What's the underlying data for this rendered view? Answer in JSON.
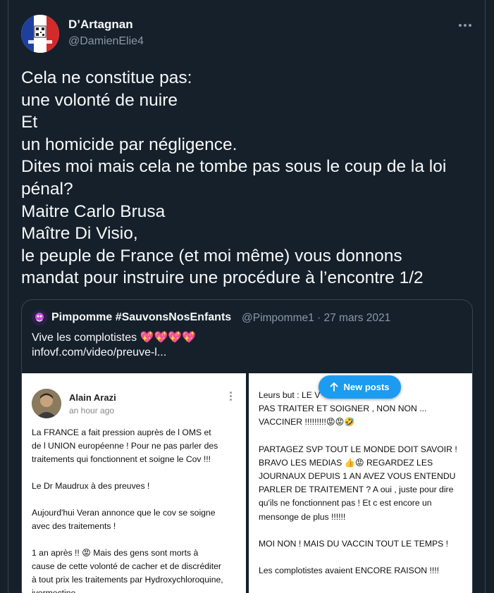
{
  "tweet": {
    "display_name": "D’Artagnan",
    "handle": "@DamienElie4",
    "text_lines": [
      "Cela ne constitue pas:",
      "une volonté de nuire",
      "Et",
      "un homicide par négligence.",
      "Dites moi mais cela ne tombe pas sous le coup de la loi",
      "pénal?",
      "Maitre Carlo Brusa",
      "Maître Di Visio,",
      "le peuple de France (et moi même) vous donnons",
      "mandat pour instruire une procédure à l’encontre 1/2"
    ]
  },
  "quoted": {
    "display_name": "Pimpomme #SauvonsNosEnfants",
    "meta": "@Pimpomme1 · 27 mars 2021",
    "text": "Vive les complotistes 💖💖💖💖",
    "link": "infovf.com/video/preuve-l..."
  },
  "screenshot_left": {
    "author": "Alain Arazi",
    "time": "an hour ago",
    "paragraphs": [
      "La FRANCE a fait pression auprès de l OMS et\nde l UNION européenne ! Pour ne pas parler des\ntraitements qui fonctionnent et soigne le Cov !!!",
      "Le Dr Maudrux à des preuves !",
      "Aujourd'hui Veran annonce que le cov se soigne\navec des traitements !",
      "1 an après !! 😡   Mais des gens sont morts à\ncause de cette volonté de cacher et de discréditer\nà  tout prix les traitements par Hydroxychloroquine,\nivermectine..."
    ]
  },
  "screenshot_right": {
    "paragraphs": [
      "Leurs but :   LE V\nPAS TRAITER ET SOIGNER , NON NON ...\nVACCINER !!!!!!!!!😡😡🤣",
      "PARTAGEZ SVP  TOUT LE MONDE DOIT SAVOIR !\nBRAVO LES MEDIAS 👍😡 REGARDEZ LES\nJOURNAUX DEPUIS  1 AN AVEZ VOUS ENTENDU\nPARLER DE TRAITEMENT ?  A oui , juste pour dire\nqu'ils ne fonctionnent pas ! Et c est encore un\nmensonge de plus !!!!!!",
      "MOI NON ! MAIS DU VACCIN TOUT LE TEMPS !",
      "Les complotistes avaient ENCORE RAISON !!!!"
    ]
  },
  "new_posts_label": "New posts",
  "colors": {
    "background": "#15202b",
    "border": "#38444d",
    "text_primary": "#f7f9f9",
    "text_secondary": "#8b98a5",
    "accent": "#1d9bf0"
  },
  "icons": {
    "more": "more-horizontal-icon",
    "arrow": "arrow-up-icon"
  }
}
